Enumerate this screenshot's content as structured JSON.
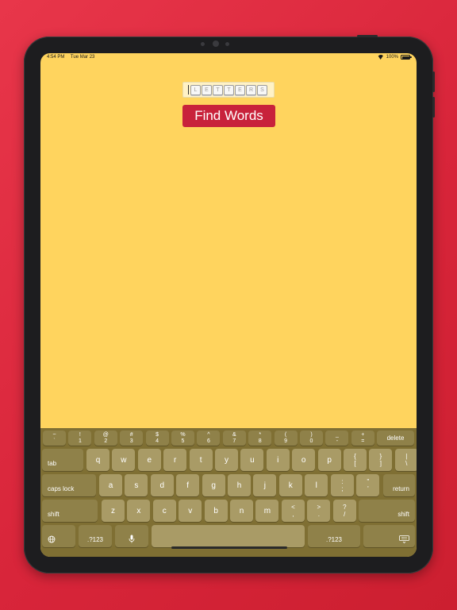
{
  "status": {
    "time": "4:54 PM",
    "date": "Tue Mar 23",
    "battery": "100%"
  },
  "letters_input": {
    "placeholder": "LETTERS",
    "tiles": [
      "L",
      "E",
      "T",
      "T",
      "E",
      "R",
      "S"
    ]
  },
  "find_button": {
    "label": "Find Words"
  },
  "keyboard": {
    "number_row": [
      {
        "top": "~",
        "bottom": "`"
      },
      {
        "top": "!",
        "bottom": "1"
      },
      {
        "top": "@",
        "bottom": "2"
      },
      {
        "top": "#",
        "bottom": "3"
      },
      {
        "top": "$",
        "bottom": "4"
      },
      {
        "top": "%",
        "bottom": "5"
      },
      {
        "top": "^",
        "bottom": "6"
      },
      {
        "top": "&",
        "bottom": "7"
      },
      {
        "top": "*",
        "bottom": "8"
      },
      {
        "top": "(",
        "bottom": "9"
      },
      {
        "top": ")",
        "bottom": "0"
      },
      {
        "top": "_",
        "bottom": "-"
      },
      {
        "top": "+",
        "bottom": "="
      }
    ],
    "delete": "delete",
    "tab": "tab",
    "row1": [
      "q",
      "w",
      "e",
      "r",
      "t",
      "y",
      "u",
      "i",
      "o",
      "p"
    ],
    "row1_extra": [
      {
        "top": "{",
        "bottom": "["
      },
      {
        "top": "}",
        "bottom": "]"
      },
      {
        "top": "|",
        "bottom": "\\"
      }
    ],
    "caps_lock": "caps lock",
    "row2": [
      "a",
      "s",
      "d",
      "f",
      "g",
      "h",
      "j",
      "k",
      "l"
    ],
    "row2_extra": [
      {
        "top": ":",
        "bottom": ";"
      },
      {
        "top": "\"",
        "bottom": "'"
      }
    ],
    "return": "return",
    "shift_left": "shift",
    "row3": [
      "z",
      "x",
      "c",
      "v",
      "b",
      "n",
      "m"
    ],
    "row3_extra": [
      {
        "top": "<",
        "bottom": ","
      },
      {
        "top": ">",
        "bottom": "."
      },
      {
        "top": "?",
        "bottom": "/"
      }
    ],
    "shift_right": "shift",
    "numbers_left": ".?123",
    "numbers_right": ".?123"
  }
}
